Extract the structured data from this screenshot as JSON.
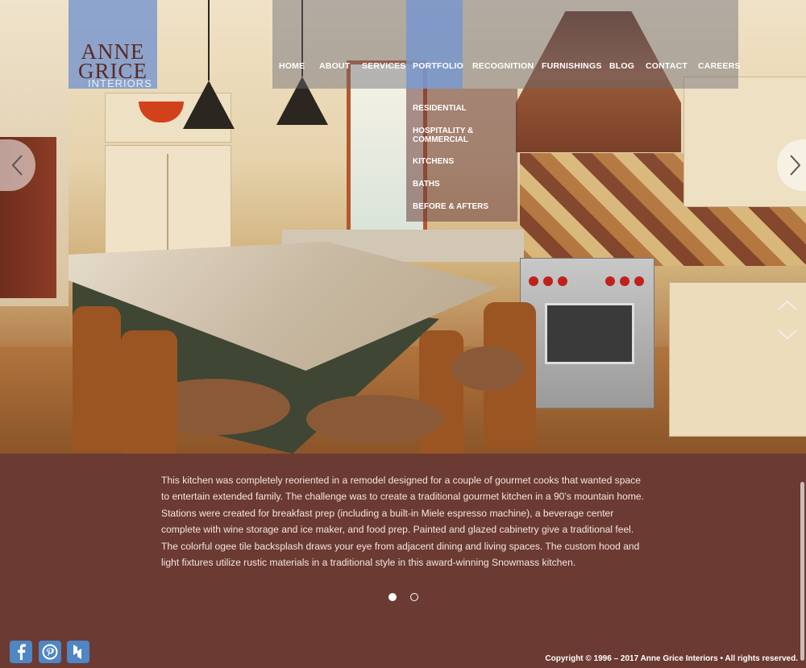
{
  "logo": {
    "name": "ANNE GRICE",
    "sub": "INTERIORS"
  },
  "nav": {
    "items": [
      "HOME",
      "ABOUT",
      "SERVICES",
      "PORTFOLIO",
      "RECOGNITION",
      "FURNISHINGS",
      "BLOG",
      "CONTACT",
      "CAREERS"
    ],
    "active": "PORTFOLIO"
  },
  "portfolio_menu": [
    "RESIDENTIAL",
    "HOSPITALITY &",
    "COMMERCIAL",
    "KITCHENS",
    "BATHS",
    "BEFORE & AFTERS"
  ],
  "slider": {
    "prev_icon": "chevron-left-icon",
    "next_icon": "chevron-right-icon",
    "dots": 2,
    "active_dot": 1
  },
  "description": "This kitchen was completely reoriented in a remodel designed for a couple of gourmet cooks that wanted space to entertain extended family. The challenge was to create a traditional gourmet kitchen in a 90’s mountain home. Stations were created for breakfast prep (including a built-in Miele espresso machine), a beverage center complete with wine storage and ice maker, and food prep. Painted and glazed cabinetry give a traditional feel. The colorful ogee tile backsplash draws your eye from adjacent dining and living spaces. The custom hood and light fixtures utilize rustic materials in a traditional style in this award-winning Snowmass kitchen.",
  "social": [
    "facebook-icon",
    "pinterest-icon",
    "houzz-icon"
  ],
  "copyright": "Copyright © 1996 – 2017 Anne Grice Interiors • All rights reserved.",
  "colors": {
    "background": "#6b3a32",
    "accent": "#7896cd"
  }
}
